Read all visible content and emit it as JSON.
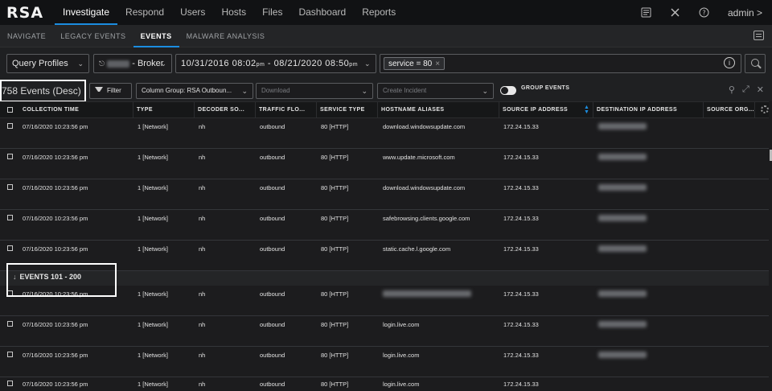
{
  "app": {
    "logo": "RSA"
  },
  "topnav": {
    "items": [
      "Investigate",
      "Respond",
      "Users",
      "Hosts",
      "Files",
      "Dashboard",
      "Reports"
    ],
    "active": "Investigate",
    "admin": "admin >"
  },
  "subnav": {
    "items": [
      "NAVIGATE",
      "LEGACY EVENTS",
      "EVENTS",
      "MALWARE ANALYSIS"
    ],
    "active": "EVENTS"
  },
  "querybar": {
    "query_profiles": "Query Profiles",
    "service_suffix": "- Broker",
    "time_range_start": "10/31/2016 08:02",
    "time_range_start_ampm": "pm",
    "time_range_sep": " - ",
    "time_range_end": "08/21/2020 08:50",
    "time_range_end_ampm": "pm",
    "filter_pill": "service = 80"
  },
  "toolbar": {
    "event_count": "758 Events (Desc)",
    "filter_label": "Filter",
    "column_group": "Column Group: RSA Outboun...",
    "download_placeholder": "Download",
    "create_incident_placeholder": "Create Incident",
    "group_events_label": "GROUP EVENTS"
  },
  "table": {
    "columns": [
      "COLLECTION TIME",
      "TYPE",
      "DECODER SO...",
      "TRAFFIC FLO...",
      "SERVICE TYPE",
      "HOSTNAME ALIASES",
      "SOURCE IP ADDRESS",
      "DESTINATION IP ADDRESS",
      "SOURCE ORG..."
    ],
    "rows": [
      {
        "time": "07/16/2020 10:23:56 pm",
        "type": "1 [Network]",
        "decoder": "nh",
        "flow": "outbound",
        "service": "80 [HTTP]",
        "host": "download.windowsupdate.com",
        "src_ip": "172.24.15.33"
      },
      {
        "time": "07/16/2020 10:23:56 pm",
        "type": "1 [Network]",
        "decoder": "nh",
        "flow": "outbound",
        "service": "80 [HTTP]",
        "host": "www.update.microsoft.com",
        "src_ip": "172.24.15.33"
      },
      {
        "time": "07/16/2020 10:23:56 pm",
        "type": "1 [Network]",
        "decoder": "nh",
        "flow": "outbound",
        "service": "80 [HTTP]",
        "host": "download.windowsupdate.com",
        "src_ip": "172.24.15.33"
      },
      {
        "time": "07/16/2020 10:23:56 pm",
        "type": "1 [Network]",
        "decoder": "nh",
        "flow": "outbound",
        "service": "80 [HTTP]",
        "host": "safebrowsing.clients.google.com",
        "src_ip": "172.24.15.33"
      },
      {
        "time": "07/16/2020 10:23:56 pm",
        "type": "1 [Network]",
        "decoder": "nh",
        "flow": "outbound",
        "service": "80 [HTTP]",
        "host": "static.cache.l.google.com",
        "src_ip": "172.24.15.33"
      },
      {
        "time": "07/16/2020 10:23:56 pm",
        "type": "1 [Network]",
        "decoder": "nh",
        "flow": "outbound",
        "service": "80 [HTTP]",
        "host": "",
        "src_ip": "172.24.15.33"
      },
      {
        "time": "07/16/2020 10:23:56 pm",
        "type": "1 [Network]",
        "decoder": "nh",
        "flow": "outbound",
        "service": "80 [HTTP]",
        "host": "login.live.com",
        "src_ip": "172.24.15.33"
      },
      {
        "time": "07/16/2020 10:23:56 pm",
        "type": "1 [Network]",
        "decoder": "nh",
        "flow": "outbound",
        "service": "80 [HTTP]",
        "host": "login.live.com",
        "src_ip": "172.24.15.33"
      },
      {
        "time": "07/16/2020 10:23:56 pm",
        "type": "1 [Network]",
        "decoder": "nh",
        "flow": "outbound",
        "service": "80 [HTTP]",
        "host": "login.live.com",
        "src_ip": "172.24.15.33"
      }
    ],
    "group_label": "EVENTS 101 - 200",
    "group_arrow": "↓"
  },
  "colors": {
    "accent": "#1b8de0",
    "highlight": "#ffffff"
  }
}
